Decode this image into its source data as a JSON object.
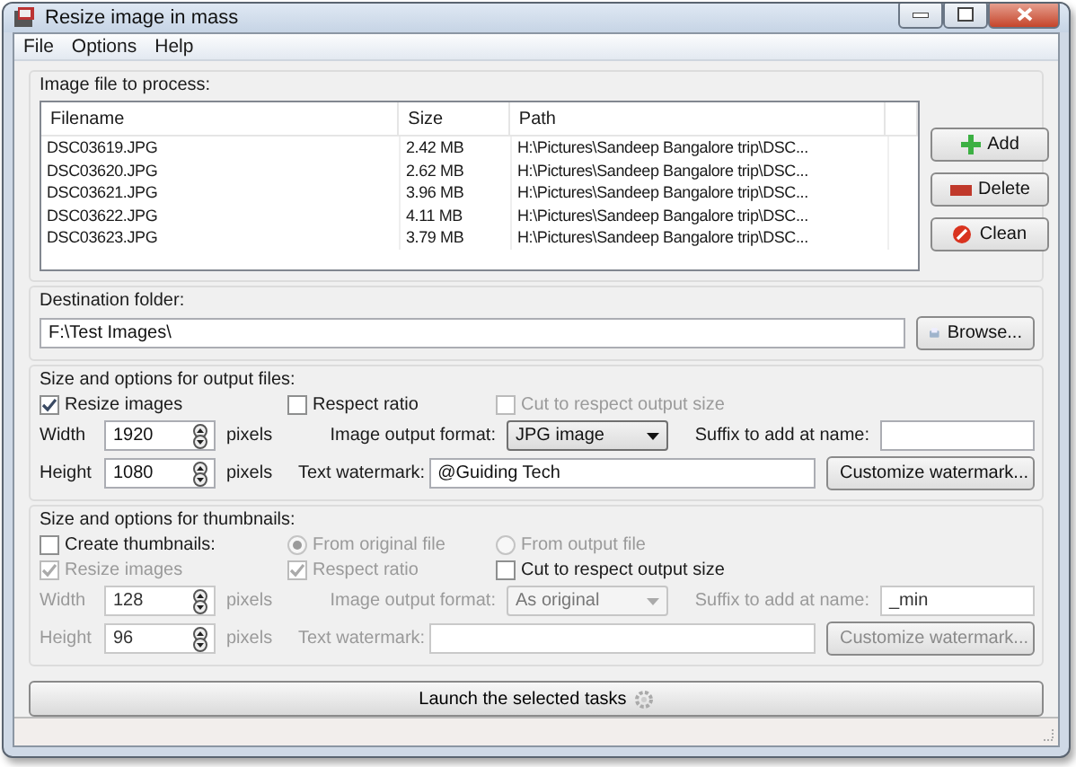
{
  "window": {
    "title": "Resize image in mass"
  },
  "menu": [
    "File",
    "Options",
    "Help"
  ],
  "files": {
    "title": "Image file to process:",
    "columns": [
      "Filename",
      "Size",
      "Path"
    ],
    "rows": [
      {
        "filename": "DSC03619.JPG",
        "size": "2.42 MB",
        "path": "H:\\Pictures\\Sandeep Bangalore trip\\DSC..."
      },
      {
        "filename": "DSC03620.JPG",
        "size": "2.62 MB",
        "path": "H:\\Pictures\\Sandeep Bangalore trip\\DSC..."
      },
      {
        "filename": "DSC03621.JPG",
        "size": "3.96 MB",
        "path": "H:\\Pictures\\Sandeep Bangalore trip\\DSC..."
      },
      {
        "filename": "DSC03622.JPG",
        "size": "4.11 MB",
        "path": "H:\\Pictures\\Sandeep Bangalore trip\\DSC..."
      },
      {
        "filename": "DSC03623.JPG",
        "size": "3.79 MB",
        "path": "H:\\Pictures\\Sandeep Bangalore trip\\DSC..."
      }
    ],
    "buttons": [
      {
        "kind": "add",
        "label": "Add"
      },
      {
        "kind": "delete",
        "label": "Delete"
      },
      {
        "kind": "clean",
        "label": "Clean"
      }
    ]
  },
  "destination": {
    "title": "Destination folder:",
    "value": "F:\\Test Images\\",
    "button": "Browse..."
  },
  "sections": [
    {
      "title": "Size and options for output files:",
      "checks": [
        {
          "label": "Resize images",
          "checked": true,
          "disabled": false
        },
        {
          "label": "Respect ratio",
          "checked": false,
          "disabled": false
        },
        {
          "label": "Cut to respect output size",
          "checked": false,
          "disabled": true
        }
      ],
      "width": {
        "label": "Width",
        "value": "1920",
        "unit": "pixels"
      },
      "height": {
        "label": "Height",
        "value": "1080",
        "unit": "pixels"
      },
      "format": {
        "label": "Image output format:",
        "value": "JPG image"
      },
      "suffix": {
        "label": "Suffix to add at name:"
      },
      "watermark": {
        "label": "Text watermark:",
        "value": "@Guiding Tech"
      },
      "customize": "Customize watermark...",
      "disabled": false
    },
    {
      "title": "Size and options for thumbnails:",
      "top": {
        "create": {
          "label": "Create thumbnails:",
          "checked": false
        },
        "radios": [
          {
            "label": "From original file",
            "selected": true
          },
          {
            "label": "From output file",
            "selected": false
          }
        ]
      },
      "checks": [
        {
          "label": "Resize images",
          "checked": true,
          "disabled": true
        },
        {
          "label": "Respect ratio",
          "checked": true,
          "disabled": true
        },
        {
          "label": "Cut to respect output size",
          "checked": false,
          "disabled": false
        }
      ],
      "width": {
        "label": "Width",
        "value": "128",
        "unit": "pixels"
      },
      "height": {
        "label": "Height",
        "value": "96",
        "unit": "pixels"
      },
      "format": {
        "label": "Image output format:",
        "value": "As original"
      },
      "suffix": {
        "label": "Suffix to add at name:",
        "value": "_min"
      },
      "watermark": {
        "label": "Text watermark:"
      },
      "customize": "Customize watermark...",
      "disabled": true
    }
  ],
  "launch": "Launch the selected tasks"
}
